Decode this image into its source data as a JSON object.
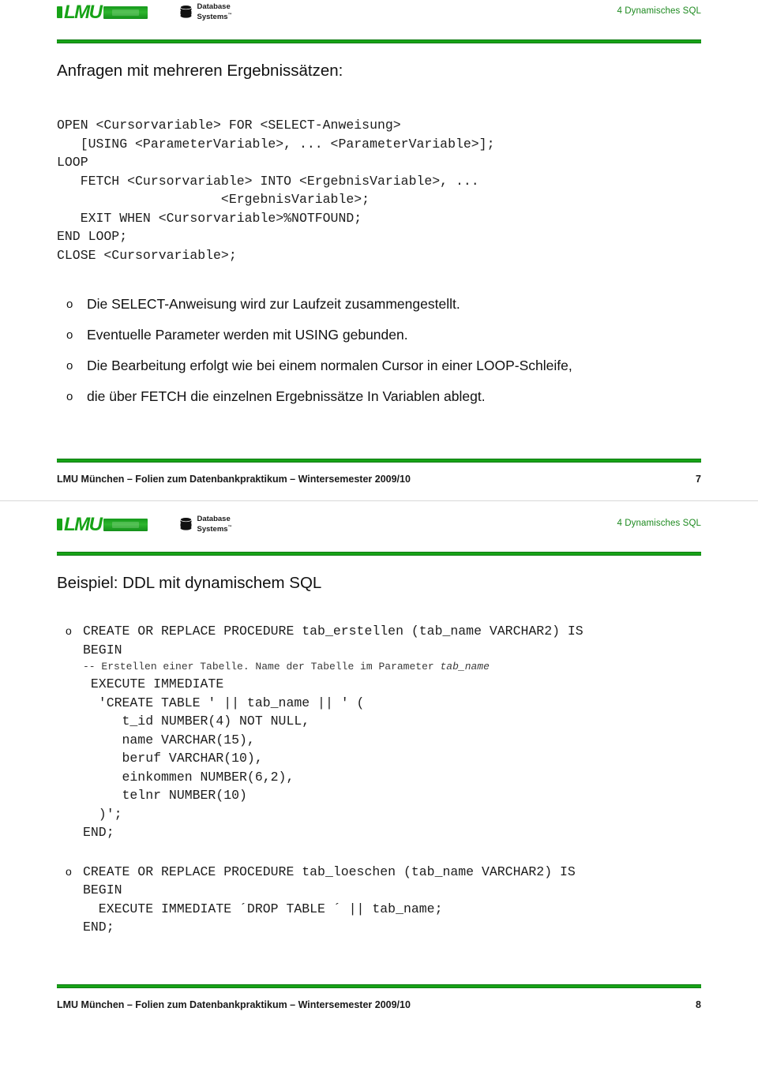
{
  "document": {
    "chapter_label": "4  Dynamisches SQL",
    "brand": {
      "lmu_text": "LMU",
      "db_line1": "Database",
      "db_line2": "Systems",
      "db_sup": "™"
    },
    "footer_text": "LMU München – Folien zum Datenbankpraktikum – Wintersemester 2009/10",
    "accent_green": "#17a317",
    "header_green_text": "#1e8a20"
  },
  "slide7": {
    "page_number": "7",
    "title": "Anfragen mit mehreren Ergebnissätzen:",
    "code": "OPEN <Cursorvariable> FOR <SELECT-Anweisung>\n   [USING <ParameterVariable>, ... <ParameterVariable>];\nLOOP\n   FETCH <Cursorvariable> INTO <ErgebnisVariable>, ...\n                     <ErgebnisVariable>;\n   EXIT WHEN <Cursorvariable>%NOTFOUND;\nEND LOOP;\nCLOSE <Cursorvariable>;",
    "bullets": [
      {
        "mark": "o",
        "text": "Die SELECT-Anweisung wird zur Laufzeit zusammengestellt."
      },
      {
        "mark": "o",
        "text": "Eventuelle Parameter werden mit USING gebunden."
      },
      {
        "mark": "o",
        "text": " Die Bearbeitung erfolgt wie bei einem normalen Cursor in einer LOOP-Schleife,"
      },
      {
        "mark": "o",
        "text": "die über FETCH die einzelnen Ergebnissätze In Variablen ablegt."
      }
    ]
  },
  "slide8": {
    "page_number": "8",
    "title": "Beispiel: DDL mit dynamischem SQL",
    "block1": {
      "mark": "o",
      "head": "CREATE OR REPLACE PROCEDURE tab_erstellen (tab_name VARCHAR2) IS\nBEGIN",
      "comment_prefix": "-- Erstellen einer Tabelle. Name der Tabelle im Parameter ",
      "comment_italic": "tab_name",
      "tail": " EXECUTE IMMEDIATE\n  'CREATE TABLE ' || tab_name || ' (\n     t_id NUMBER(4) NOT NULL,\n     name VARCHAR(15),\n     beruf VARCHAR(10),\n     einkommen NUMBER(6,2),\n     telnr NUMBER(10)\n  )';\nEND;"
    },
    "block2": {
      "mark": "o",
      "code": "CREATE OR REPLACE PROCEDURE tab_loeschen (tab_name VARCHAR2) IS\nBEGIN\n  EXECUTE IMMEDIATE ´DROP TABLE ´ || tab_name;\nEND;"
    }
  }
}
